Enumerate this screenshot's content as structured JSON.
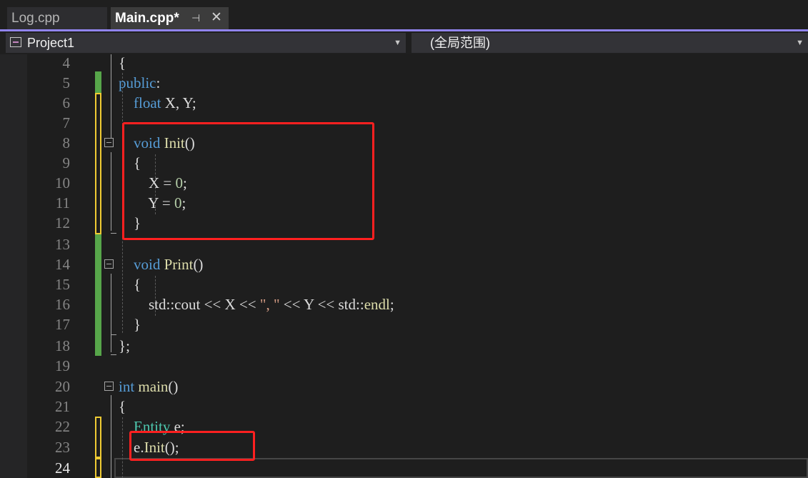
{
  "tabs": [
    {
      "label": "Log.cpp",
      "active": false
    },
    {
      "label": "Main.cpp*",
      "active": true,
      "pin_icon": "pin-icon",
      "close_icon": "close-icon"
    }
  ],
  "navbar": {
    "project": "Project1",
    "scope": "(全局范围)"
  },
  "colors": {
    "keyword": "#569cd6",
    "function": "#dcdcaa",
    "type": "#4ec9b0",
    "number": "#b5cea8",
    "string": "#d69d85",
    "highlight": "#ff2020",
    "accent": "#9184ee"
  },
  "editor": {
    "current_line": "24",
    "lines": [
      {
        "n": "4",
        "text": "{"
      },
      {
        "n": "5",
        "text": "public:"
      },
      {
        "n": "6",
        "text": "    float X, Y;"
      },
      {
        "n": "7",
        "text": ""
      },
      {
        "n": "8",
        "text": "    void Init()"
      },
      {
        "n": "9",
        "text": "    {"
      },
      {
        "n": "10",
        "text": "        X = 0;"
      },
      {
        "n": "11",
        "text": "        Y = 0;"
      },
      {
        "n": "12",
        "text": "    }"
      },
      {
        "n": "13",
        "text": ""
      },
      {
        "n": "14",
        "text": "    void Print()"
      },
      {
        "n": "15",
        "text": "    {"
      },
      {
        "n": "16",
        "text": "        std::cout << X << \", \" << Y << std::endl;"
      },
      {
        "n": "17",
        "text": "    }"
      },
      {
        "n": "18",
        "text": "};"
      },
      {
        "n": "19",
        "text": ""
      },
      {
        "n": "20",
        "text": "int main()"
      },
      {
        "n": "21",
        "text": "{"
      },
      {
        "n": "22",
        "text": "    Entity e;"
      },
      {
        "n": "23",
        "text": "    e.Init();"
      },
      {
        "n": "24",
        "text": ""
      }
    ]
  }
}
